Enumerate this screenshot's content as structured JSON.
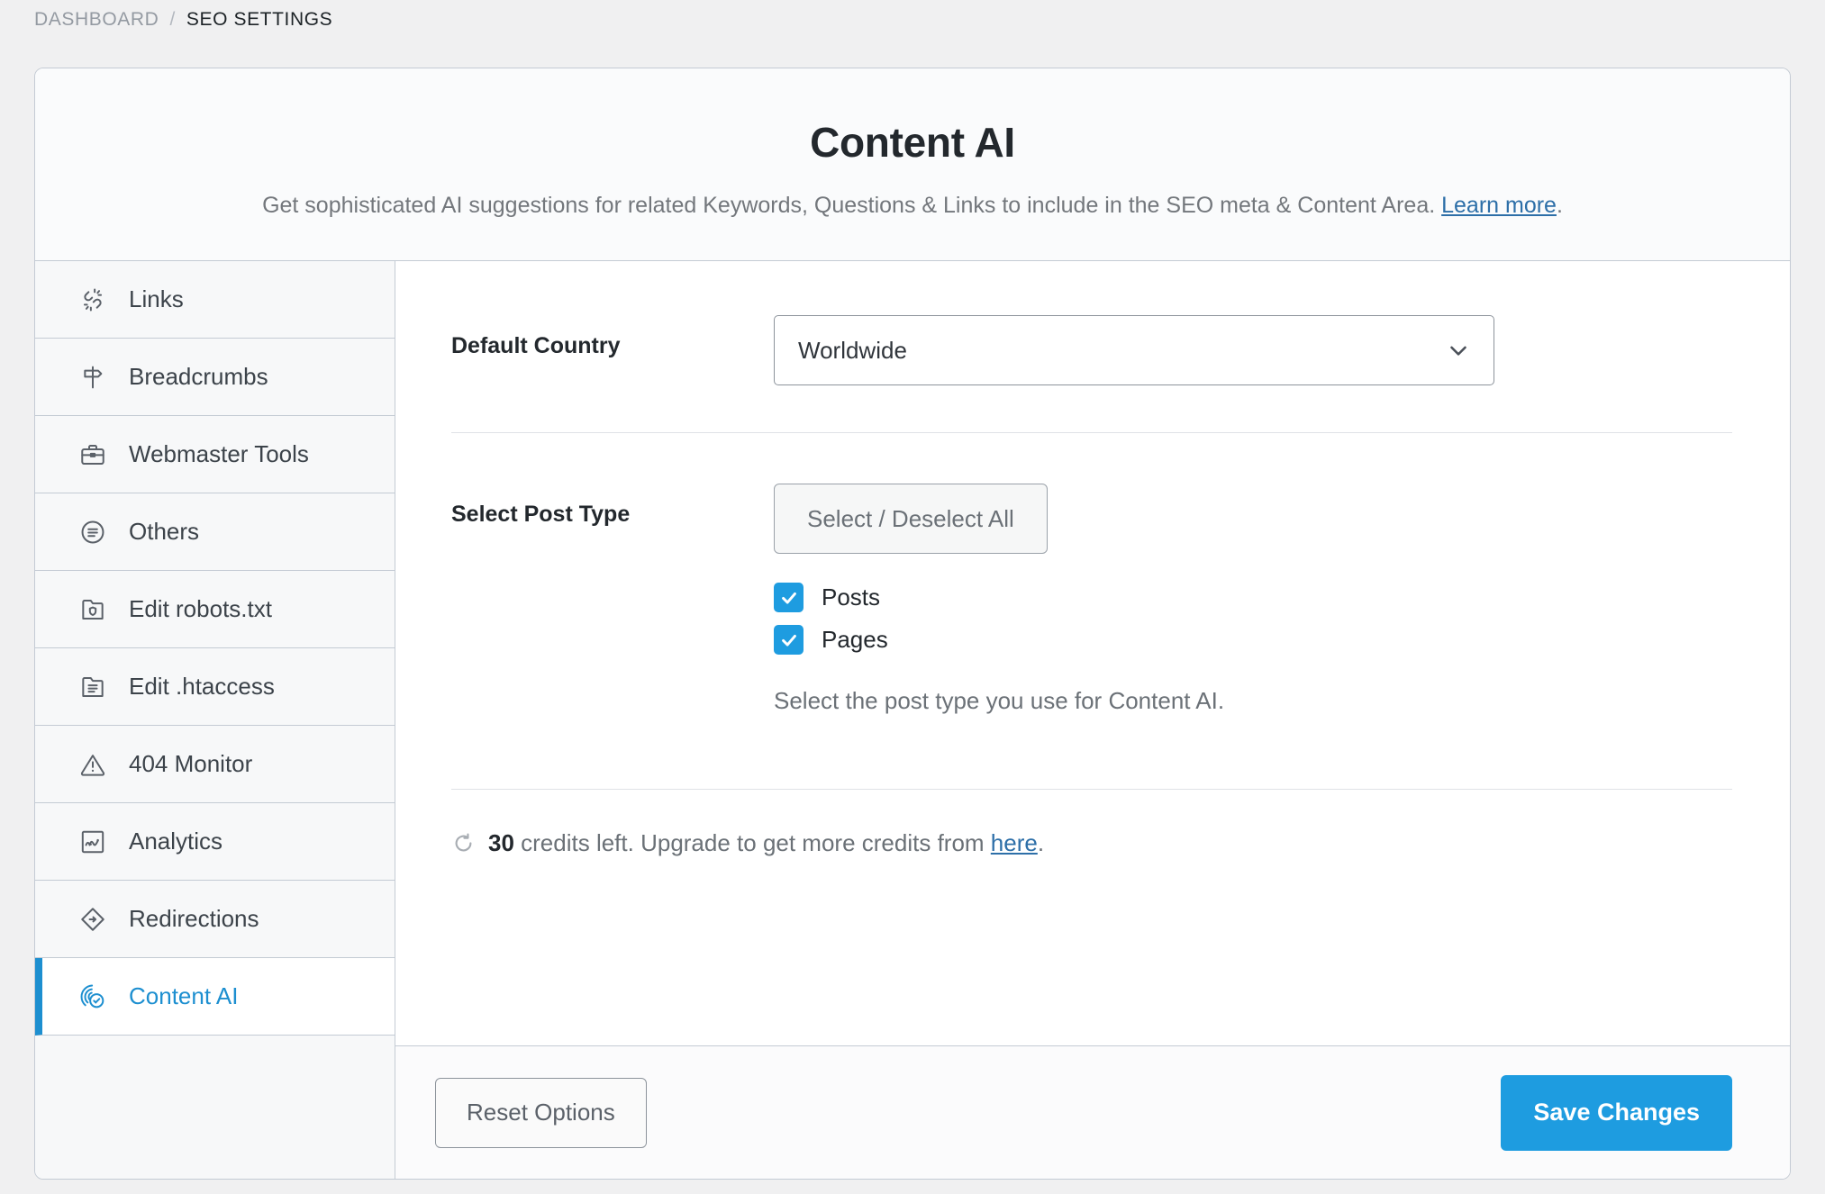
{
  "breadcrumb": {
    "parent": "DASHBOARD",
    "separator": "/",
    "current": "SEO SETTINGS"
  },
  "header": {
    "title": "Content AI",
    "description_before": "Get sophisticated AI suggestions for related Keywords, Questions & Links to include in the SEO meta & Content Area. ",
    "learn_more": "Learn more",
    "description_after": "."
  },
  "sidebar": {
    "items": [
      {
        "label": "Links",
        "icon": "broken-link-icon",
        "active": false
      },
      {
        "label": "Breadcrumbs",
        "icon": "signpost-icon",
        "active": false
      },
      {
        "label": "Webmaster Tools",
        "icon": "briefcase-icon",
        "active": false
      },
      {
        "label": "Others",
        "icon": "list-circle-icon",
        "active": false
      },
      {
        "label": "Edit robots.txt",
        "icon": "folder-shield-icon",
        "active": false
      },
      {
        "label": "Edit .htaccess",
        "icon": "folder-lines-icon",
        "active": false
      },
      {
        "label": "404 Monitor",
        "icon": "warning-triangle-icon",
        "active": false
      },
      {
        "label": "Analytics",
        "icon": "chart-square-icon",
        "active": false
      },
      {
        "label": "Redirections",
        "icon": "diamond-arrow-icon",
        "active": false
      },
      {
        "label": "Content AI",
        "icon": "fingerprint-check-icon",
        "active": true
      }
    ]
  },
  "form": {
    "default_country": {
      "label": "Default Country",
      "value": "Worldwide",
      "chevron": "chevron-down-icon"
    },
    "post_type": {
      "label": "Select Post Type",
      "select_all_label": "Select / Deselect All",
      "options": [
        {
          "label": "Posts",
          "checked": true
        },
        {
          "label": "Pages",
          "checked": true
        }
      ],
      "helper": "Select the post type you use for Content AI."
    },
    "credits": {
      "icon": "refresh-icon",
      "count": "30",
      "text_before": " credits left. Upgrade to get more credits from ",
      "link": "here",
      "text_after": "."
    }
  },
  "footer": {
    "reset_label": "Reset Options",
    "save_label": "Save Changes"
  },
  "colors": {
    "accent": "#1e9ce0",
    "link": "#2d6fa8",
    "border": "#c4cbd4",
    "sidebar_bg": "#f7f8f9",
    "page_bg": "#f0f0f1"
  }
}
